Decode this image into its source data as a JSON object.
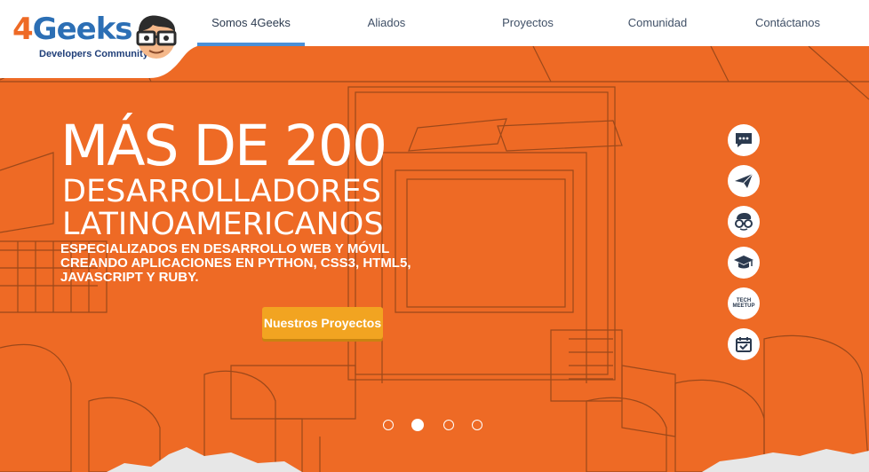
{
  "logo": {
    "text_four": "4",
    "text_geeks": "Geeks",
    "subtitle": "Developers Community"
  },
  "nav": {
    "items": [
      {
        "label": "Somos 4Geeks",
        "active": true
      },
      {
        "label": "Aliados",
        "active": false
      },
      {
        "label": "Proyectos",
        "active": false
      },
      {
        "label": "Comunidad",
        "active": false
      },
      {
        "label": "Contáctanos",
        "active": false
      }
    ]
  },
  "hero": {
    "headline": "MÁS DE 200",
    "subhead_line1": "DESARROLLADORES",
    "subhead_line2": "LATINOAMERICANOS",
    "tagline": "ESPECIALIZADOS EN DESARROLLO WEB Y MÓVIL CREANDO APLICACIONES EN PYTHON, CSS3, HTML5, JAVASCRIPT Y RUBY.",
    "cta_label": "Nuestros Proyectos"
  },
  "side_icons": [
    {
      "name": "chat-icon"
    },
    {
      "name": "paper-plane-icon"
    },
    {
      "name": "geek-face-icon"
    },
    {
      "name": "graduation-cap-icon"
    },
    {
      "name": "tech-meetup-icon",
      "text": "TECH MEETUP"
    },
    {
      "name": "calendar-check-icon"
    }
  ],
  "carousel": {
    "total": 4,
    "active_index": 1
  },
  "colors": {
    "hero_bg": "#EE6A25",
    "accent_blue": "#4A90D9",
    "cta": "#F2A421",
    "navy": "#2B3A4F"
  }
}
